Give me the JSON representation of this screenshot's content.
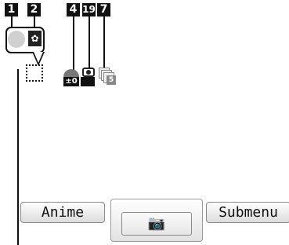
{
  "callouts": [
    "1",
    "2",
    "4",
    "19",
    "7"
  ],
  "status_icons": {
    "focus_indicator": "circle-icon",
    "macro_mode": "macro-icon",
    "exposure_value": "±0",
    "storage_icon": "camera-storage-icon",
    "burst_count": "5"
  },
  "softkeys": {
    "left_label": "Anime",
    "center_glyph": "📷",
    "right_label": "Submenu"
  }
}
